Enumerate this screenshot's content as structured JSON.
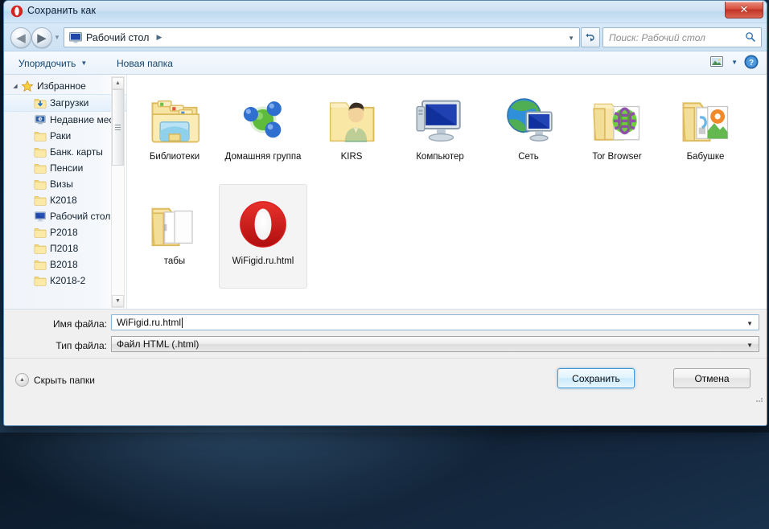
{
  "window": {
    "title": "Сохранить как",
    "app_icon": "opera-logo-icon",
    "close_label": "✕"
  },
  "nav": {
    "back_icon": "arrow-left-icon",
    "back_glyph": "◀",
    "forward_icon": "arrow-right-icon",
    "forward_glyph": "▶",
    "history_caret": "▼",
    "address_icon": "desktop-monitor-icon",
    "address_text": "Рабочий стол",
    "address_separator": "▶",
    "address_caret": "▼",
    "refresh_icon": "refresh-icon",
    "search_placeholder": "Поиск: Рабочий стол",
    "search_value": "",
    "search_icon": "magnifier-icon"
  },
  "toolbar": {
    "organize_label": "Упорядочить",
    "organize_caret": "▼",
    "new_folder_label": "Новая папка",
    "view_icon": "view-mode-icon",
    "view_caret": "▼",
    "help_icon": "help-question-icon",
    "help_glyph": "?"
  },
  "sidebar": {
    "scrollbar": {
      "up_glyph": "▲",
      "down_glyph": "▼"
    },
    "items": [
      {
        "label": "Избранное",
        "icon": "star-icon",
        "indent": 0,
        "twisty": "◢",
        "selected": false
      },
      {
        "label": "Загрузки",
        "icon": "downloads-folder-icon",
        "indent": 1,
        "twisty": "",
        "selected": true
      },
      {
        "label": "Недавние места",
        "icon": "recent-places-icon",
        "indent": 1,
        "twisty": "",
        "selected": false
      },
      {
        "label": "Раки",
        "icon": "folder-icon",
        "indent": 1,
        "twisty": "",
        "selected": false
      },
      {
        "label": "Банк. карты",
        "icon": "folder-icon",
        "indent": 1,
        "twisty": "",
        "selected": false
      },
      {
        "label": "Пенсии",
        "icon": "folder-icon",
        "indent": 1,
        "twisty": "",
        "selected": false
      },
      {
        "label": "Визы",
        "icon": "folder-icon",
        "indent": 1,
        "twisty": "",
        "selected": false
      },
      {
        "label": "К2018",
        "icon": "folder-icon",
        "indent": 1,
        "twisty": "",
        "selected": false
      },
      {
        "label": "Рабочий стол",
        "icon": "desktop-monitor-icon",
        "indent": 1,
        "twisty": "",
        "selected": false
      },
      {
        "label": "Р2018",
        "icon": "folder-icon",
        "indent": 1,
        "twisty": "",
        "selected": false
      },
      {
        "label": "П2018",
        "icon": "folder-icon",
        "indent": 1,
        "twisty": "",
        "selected": false
      },
      {
        "label": "В2018",
        "icon": "folder-icon",
        "indent": 1,
        "twisty": "",
        "selected": false
      },
      {
        "label": "К2018-2",
        "icon": "folder-icon",
        "indent": 1,
        "twisty": "",
        "selected": false
      }
    ]
  },
  "files": {
    "items": [
      {
        "label": "Библиотеки",
        "icon": "libraries-folder-icon",
        "selected": false
      },
      {
        "label": "Домашняя группа",
        "icon": "homegroup-icon",
        "selected": false
      },
      {
        "label": "KIRS",
        "icon": "user-folder-icon",
        "selected": false
      },
      {
        "label": "Компьютер",
        "icon": "computer-icon",
        "selected": false
      },
      {
        "label": "Сеть",
        "icon": "network-icon",
        "selected": false
      },
      {
        "label": "Tor Browser",
        "icon": "tor-folder-icon",
        "selected": false
      },
      {
        "label": "Бабушке",
        "icon": "documents-folder-icon",
        "selected": false
      },
      {
        "label": "табы",
        "icon": "open-folder-icon",
        "selected": false
      },
      {
        "label": "WiFigid.ru.html",
        "icon": "opera-html-file-icon",
        "selected": true
      }
    ]
  },
  "form": {
    "filename_label": "Имя файла:",
    "filename_value": "WiFigid.ru.html",
    "filename_caret": "▼",
    "filetype_label": "Тип файла:",
    "filetype_value": "Файл HTML (.html)",
    "filetype_caret": "▼"
  },
  "footer": {
    "hide_folders_label": "Скрыть папки",
    "hide_folders_glyph": "▲",
    "save_label": "Сохранить",
    "cancel_label": "Отмена"
  },
  "colors": {
    "accent": "#3c95d4",
    "opera_red": "#d6231e",
    "folder_yellow": "#f7e39c",
    "close_red": "#c03427"
  }
}
